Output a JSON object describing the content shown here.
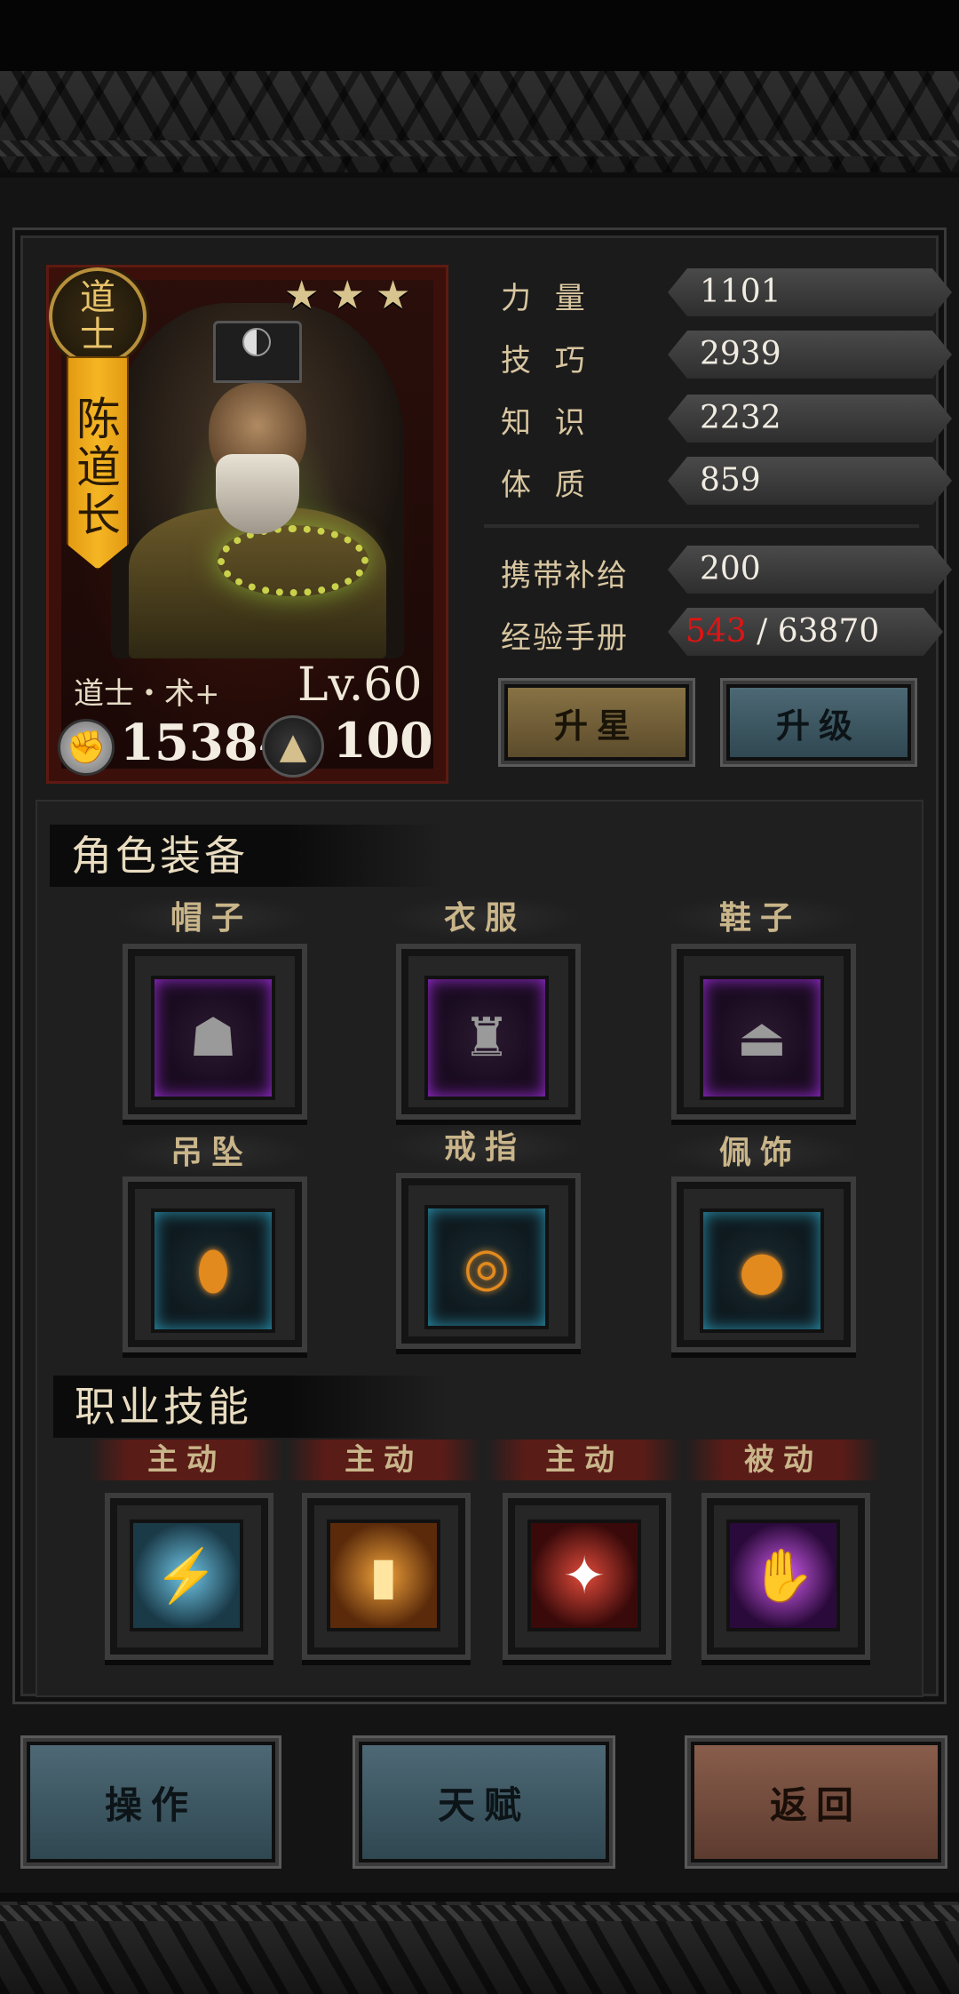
{
  "character": {
    "rank_badge": "道士",
    "name": "陈道长",
    "stars": [
      "★",
      "★",
      "★"
    ],
    "class_label": "道士・术+",
    "level": "Lv.60",
    "power": "15384",
    "supply": "100"
  },
  "stats": [
    {
      "label": "力 量",
      "value": "1101"
    },
    {
      "label": "技 巧",
      "value": "2939"
    },
    {
      "label": "知 识",
      "value": "2232"
    },
    {
      "label": "体 质",
      "value": "859"
    }
  ],
  "extra_stats": {
    "carry_supply_label": "携带补给",
    "carry_supply_value": "200",
    "exp_book_label": "经验手册",
    "exp_current": "543",
    "exp_sep": " / ",
    "exp_max": "63870"
  },
  "buttons": {
    "star_up": "升星",
    "level_up": "升级",
    "operate": "操作",
    "talent": "天赋",
    "back": "返回"
  },
  "equipment": {
    "title": "角色装备",
    "slots": [
      {
        "label": "帽子",
        "icon": "bandana-icon",
        "glyph": "☗"
      },
      {
        "label": "衣服",
        "icon": "robe-icon",
        "glyph": "♜"
      },
      {
        "label": "鞋子",
        "icon": "shoes-icon",
        "glyph": "⏏"
      },
      {
        "label": "吊坠",
        "icon": "pendant-icon",
        "glyph": "⬮"
      },
      {
        "label": "戒指",
        "icon": "ring-icon",
        "glyph": "◎"
      },
      {
        "label": "佩饰",
        "icon": "gourd-icon",
        "glyph": "●"
      }
    ]
  },
  "skills": {
    "title": "职业技能",
    "items": [
      {
        "type": "主动",
        "icon": "lightning-icon",
        "glyph": "⚡"
      },
      {
        "type": "主动",
        "icon": "talisman-icon",
        "glyph": "▮"
      },
      {
        "type": "主动",
        "icon": "red-strike-icon",
        "glyph": "✦"
      },
      {
        "type": "被动",
        "icon": "purple-hand-icon",
        "glyph": "✋"
      }
    ]
  },
  "icons": {
    "fist": "✊",
    "drop": "💧"
  },
  "colors": {
    "exp_current": "#e01414",
    "name_banner": "#f5b624",
    "equip_rare": "#9b2cd6",
    "equip_epic": "#2a93b0"
  }
}
